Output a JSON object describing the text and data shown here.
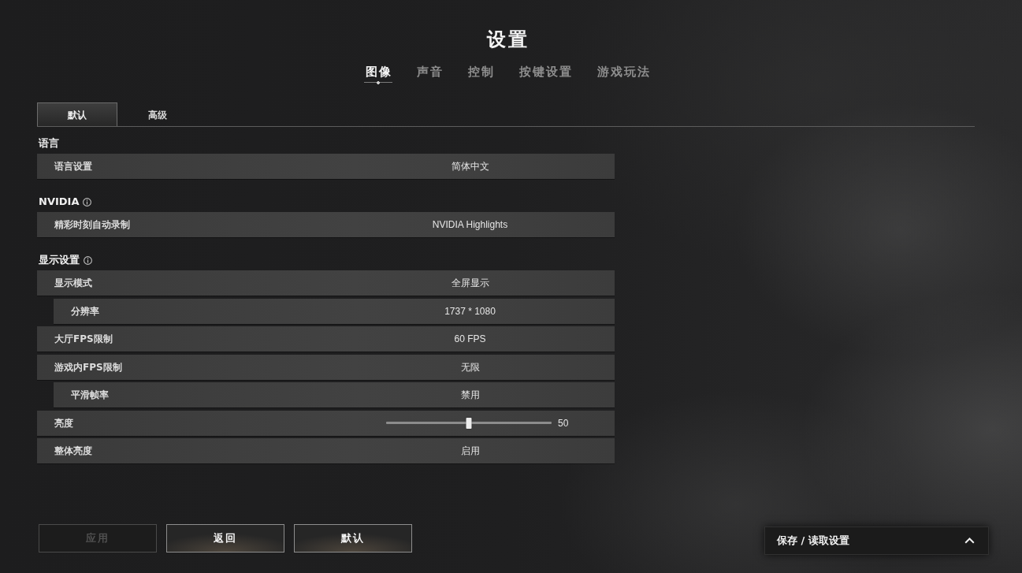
{
  "title": "设置",
  "tabs": [
    {
      "label": "图像",
      "selected": true
    },
    {
      "label": "声音",
      "selected": false
    },
    {
      "label": "控制",
      "selected": false
    },
    {
      "label": "按键设置",
      "selected": false
    },
    {
      "label": "游戏玩法",
      "selected": false
    }
  ],
  "subtabs": [
    {
      "label": "默认",
      "selected": true
    },
    {
      "label": "高级",
      "selected": false
    }
  ],
  "sections": [
    {
      "title": "语言",
      "info": false,
      "rows": [
        {
          "kind": "select",
          "label": "语言设置",
          "value": "简体中文"
        }
      ]
    },
    {
      "title": "NVIDIA",
      "info": true,
      "rows": [
        {
          "kind": "select",
          "label": "精彩时刻自动录制",
          "value": "NVIDIA Highlights"
        }
      ]
    },
    {
      "title": "显示设置",
      "info": true,
      "rows": [
        {
          "kind": "select",
          "label": "显示模式",
          "value": "全屏显示",
          "children": [
            {
              "kind": "select",
              "label": "分辨率",
              "value": "1737 * 1080"
            }
          ]
        },
        {
          "kind": "select",
          "label": "大厅FPS限制",
          "value": "60 FPS"
        },
        {
          "kind": "select",
          "label": "游戏内FPS限制",
          "value": "无限",
          "children": [
            {
              "kind": "select",
              "label": "平滑帧率",
              "value": "禁用"
            }
          ]
        },
        {
          "kind": "slider",
          "label": "亮度",
          "level": 0.5,
          "reading": "50"
        },
        {
          "kind": "select",
          "label": "整体亮度",
          "value": "启用"
        }
      ]
    }
  ],
  "buttons": [
    {
      "label": "应用",
      "disabled": true
    },
    {
      "label": "返回",
      "disabled": false
    },
    {
      "label": "默认",
      "disabled": false
    }
  ],
  "save_load": {
    "label": "保存 / 读取设置"
  }
}
